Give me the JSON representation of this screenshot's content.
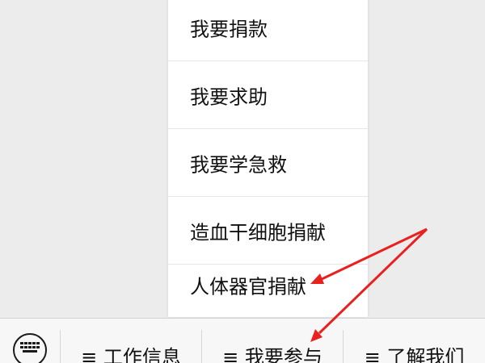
{
  "popup_menu": {
    "items": [
      {
        "label": "我要捐款"
      },
      {
        "label": "我要求助"
      },
      {
        "label": "我要学急救"
      },
      {
        "label": "造血干细胞捐献"
      },
      {
        "label": "人体器官捐献"
      }
    ]
  },
  "bottom_bar": {
    "keyboard_icon": "keyboard-icon",
    "tabs": [
      {
        "label": "≡ 工作信息"
      },
      {
        "label": "≡ 我要参与"
      },
      {
        "label": "≡ 了解我们"
      }
    ]
  },
  "annotation": {
    "arrow_color": "#e8211f"
  }
}
